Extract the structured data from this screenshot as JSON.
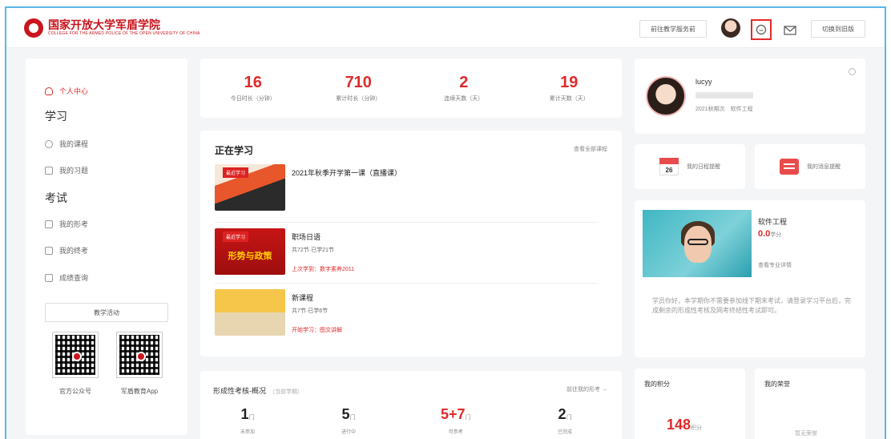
{
  "header": {
    "logo_cn": "国家开放大学军盾学院",
    "logo_en": "COLLEGE FOR THE ARMED POLICE OF THE OPEN UNIVERSITY OF CHINA",
    "front_btn": "前往教学服务前",
    "switch_btn": "切换到旧版",
    "chat_icon": "chat-icon",
    "mail_icon": "mail-icon"
  },
  "sidebar": {
    "personal": "个人中心",
    "study_head": "学习",
    "my_courses": "我的课程",
    "my_exercises": "我的习题",
    "exam_head": "考试",
    "my_formative": "我的形考",
    "my_final": "我的终考",
    "scores": "成绩查询",
    "teaching_btn": "教学活动",
    "qr1_label": "官方公众号",
    "qr2_label": "军盾教育App"
  },
  "stats": [
    {
      "num": "16",
      "label": "今日时长（分钟）"
    },
    {
      "num": "710",
      "label": "累计时长（分钟）"
    },
    {
      "num": "2",
      "label": "连续天数（天）"
    },
    {
      "num": "19",
      "label": "累计天数（天）"
    }
  ],
  "learning": {
    "title": "正在学习",
    "link": "查看全部课程",
    "courses": [
      {
        "tag": "最近学习",
        "thumb_text": "",
        "title": "2021年秋季开学第一课（直播课）",
        "sub": "",
        "meta": ""
      },
      {
        "tag": "最近学习",
        "thumb_text": "形势与政策",
        "title": "职场日语",
        "sub": "共72节·已学21节",
        "meta": "上次学到：数字素养2011"
      },
      {
        "tag": "",
        "thumb_text": "",
        "title": "新课程",
        "sub": "共7节·已学6节",
        "meta": "开始学习：图文讲解"
      }
    ]
  },
  "assessment": {
    "title": "形成性考核-概况",
    "term": "（当前学期）",
    "link": "前往我的形考 →",
    "items": [
      {
        "num": "1",
        "unit": "门",
        "label": "未参加",
        "red": false
      },
      {
        "num": "5",
        "unit": "门",
        "label": "进行中",
        "red": false
      },
      {
        "num": "5+7",
        "unit": "门",
        "label": "可参考",
        "red": true
      },
      {
        "num": "2",
        "unit": "门",
        "label": "已完成",
        "red": false
      }
    ]
  },
  "profile": {
    "name": "lucyy",
    "info": "2021秋期次　软件工程"
  },
  "mini_cards": {
    "calendar_day": "26",
    "calendar_label": "我的日程提醒",
    "message_label": "我的消息提醒"
  },
  "major": {
    "title": "软件工程",
    "score": "0.0",
    "score_unit": "学分",
    "link": "查看专业详情",
    "desc": "学员你好，本学期你不需要参加线下期末考试，请登录学习平台后，完成剩余的形成性考核及网考终结性考试即可。"
  },
  "points": {
    "title": "我的积分",
    "num": "148",
    "unit": "积分"
  },
  "honor": {
    "title": "我的荣誉",
    "empty": "暂无荣誉"
  },
  "colors": {
    "accent": "#e02a2a",
    "brand": "#c9151e",
    "frame": "#5bb6e8"
  }
}
